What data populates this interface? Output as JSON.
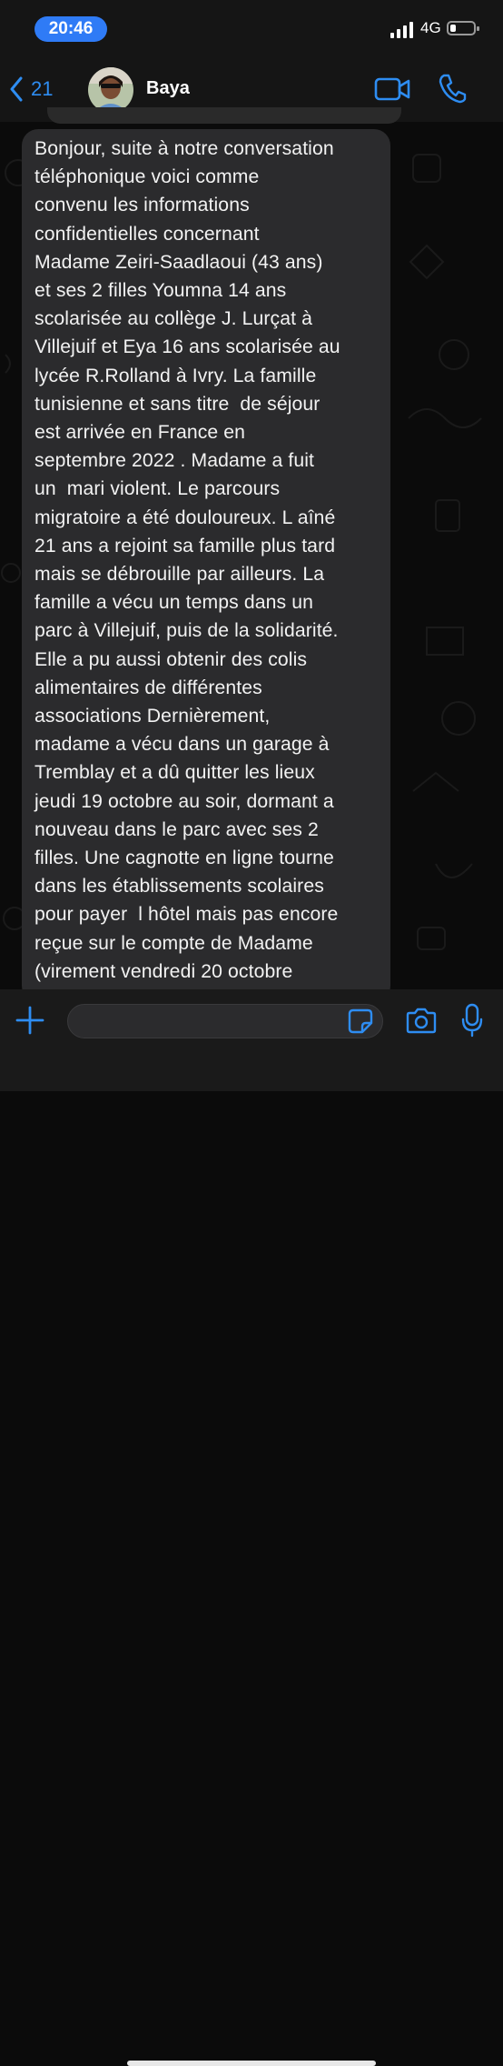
{
  "status_bar": {
    "time": "20:46",
    "network": "4G",
    "battery_level": 0.25,
    "accent_color": "#2f7bf6"
  },
  "header": {
    "back_count": "21",
    "contact_name": "Baya",
    "icons": [
      "chevron-left-icon",
      "video-call-icon",
      "phone-icon"
    ],
    "accent_color": "#2e8df2"
  },
  "message": {
    "lines": [
      "Bonjour, suite à notre conversation",
      "téléphonique voici comme",
      "convenu les informations",
      "confidentielles concernant",
      "Madame Zeiri-Saadlaoui (43 ans)",
      "et ses 2 filles Youmna 14 ans",
      "scolarisée au collège J. Lurçat à",
      "Villejuif et Eya 16 ans scolarisée au",
      "lycée R.Rolland à Ivry. La famille",
      "tunisienne et sans titre  de séjour",
      "est arrivée en France en",
      "septembre 2022 . Madame a fuit",
      "un  mari violent. Le parcours",
      "migratoire a été douloureux. L aîné",
      "21 ans a rejoint sa famille plus tard",
      "mais se débrouille par ailleurs. La",
      "famille a vécu un temps dans un",
      "parc à Villejuif, puis de la solidarité.",
      "Elle a pu aussi obtenir des colis",
      "alimentaires de différentes",
      "associations Dernièrement,",
      "madame a vécu dans un garage à",
      "Tremblay et a dû quitter les lieux",
      "jeudi 19 octobre au soir, dormant a",
      "nouveau dans le parc avec ses 2",
      "filles. Une cagnotte en ligne tourne",
      "dans les établissements scolaires",
      "pour payer  l hôtel mais pas encore",
      "reçue sur le compte de Madame",
      "(virement vendredi 20 octobre"
    ]
  },
  "input_bar": {
    "placeholder": "",
    "icons": [
      "plus-icon",
      "sticker-icon",
      "camera-icon",
      "microphone-icon"
    ]
  }
}
